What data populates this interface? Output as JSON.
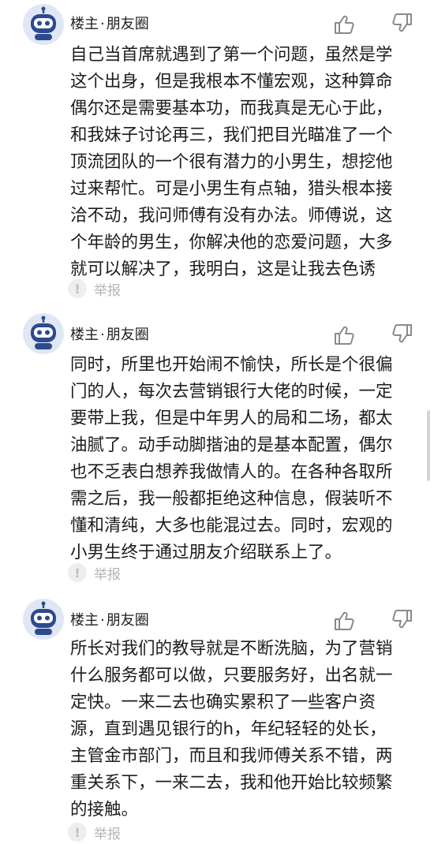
{
  "posts": [
    {
      "author_role": "楼主",
      "author_separator": "·",
      "author_name": "朋友圈",
      "lines": [
        "自己当首席就遇到了第一个问题，虽然是学",
        "这个出身，但是我根本不懂宏观，这种算命",
        "偶尔还是需要基本功，而我真是无心于此，",
        "和我妹子讨论再三，我们把目光瞄准了一个",
        "顶流团队的一个很有潜力的小男生，想挖他",
        "过来帮忙。可是小男生有点轴，猎头根本接",
        "洽不动，我问师傅有没有办法。师傅说，这",
        "个年龄的男生，你解决他的恋爱问题，大多",
        "就可以解决了，我明白，这是让我去色诱"
      ],
      "report_icon": "!",
      "report_label": "举报"
    },
    {
      "author_role": "楼主",
      "author_separator": "·",
      "author_name": "朋友圈",
      "lines": [
        "同时，所里也开始闹不愉快，所长是个很偏",
        "门的人，每次去营销银行大佬的时候，一定",
        "要带上我，但是中年男人的局和二场，都太",
        "油腻了。动手动脚揩油的是基本配置，偶尔",
        "也不乏表白想养我做情人的。在各种各取所",
        "需之后，我一般都拒绝这种信息，假装听不",
        "懂和清纯，大多也能混过去。同时，宏观的",
        "小男生终于通过朋友介绍联系上了。"
      ],
      "report_icon": "!",
      "report_label": "举报"
    },
    {
      "author_role": "楼主",
      "author_separator": "·",
      "author_name": "朋友圈",
      "lines": [
        "所长对我们的教导就是不断洗脑，为了营销",
        "什么服务都可以做，只要服务好，出名就一",
        "定快。一来二去也确实累积了一些客户资",
        "源，直到遇见银行的h，年纪轻轻的处长，",
        "主管金市部门，而且和我师傅关系不错，两",
        "重关系下，一来二去，我和他开始比较频繁",
        "的接触。"
      ],
      "report_icon": "!",
      "report_label": "举报"
    }
  ],
  "colors": {
    "avatar_bg": "#dfe7f5",
    "avatar_robot": "#2c4a8e",
    "icon_stroke": "#8a8a8a",
    "report_text": "#b5b5b5"
  },
  "icons": {
    "avatar": "robot-avatar-icon",
    "like": "thumbs-up-icon",
    "dislike": "thumbs-down-icon",
    "report": "exclamation-circle-icon"
  }
}
